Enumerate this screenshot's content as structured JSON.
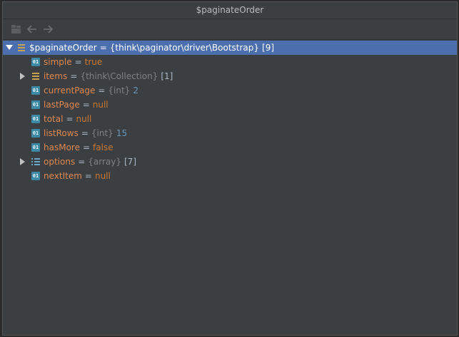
{
  "window": {
    "title": "$paginateOrder"
  },
  "toolbar": {
    "items": [
      "frames-icon",
      "back-arrow-icon",
      "forward-arrow-icon"
    ]
  },
  "tree": {
    "root": {
      "name": "$paginateOrder",
      "eq": "=",
      "type": "{think\\paginator\\driver\\Bootstrap}",
      "count": "[9]"
    },
    "children": [
      {
        "name": "simple",
        "eq": "=",
        "type": "",
        "value": "true",
        "count": ""
      },
      {
        "name": "items",
        "eq": "=",
        "type": "{think\\Collection}",
        "value": "",
        "count": "[1]"
      },
      {
        "name": "currentPage",
        "eq": "=",
        "type": "{int}",
        "value": "2",
        "count": ""
      },
      {
        "name": "lastPage",
        "eq": "=",
        "type": "",
        "value": "null",
        "count": ""
      },
      {
        "name": "total",
        "eq": "=",
        "type": "",
        "value": "null",
        "count": ""
      },
      {
        "name": "listRows",
        "eq": "=",
        "type": "{int}",
        "value": "15",
        "count": ""
      },
      {
        "name": "hasMore",
        "eq": "=",
        "type": "",
        "value": "false",
        "count": ""
      },
      {
        "name": "options",
        "eq": "=",
        "type": "{array}",
        "value": "",
        "count": "[7]"
      },
      {
        "name": "nextItem",
        "eq": "=",
        "type": "",
        "value": "null",
        "count": ""
      }
    ]
  },
  "icons": {
    "scalar": "01"
  },
  "colors": {
    "background": "#3c3f41",
    "selection": "#4b6eaf",
    "field_name": "#e0874f",
    "keyword": "#cc7832",
    "number": "#6897bb",
    "type": "#808080"
  }
}
